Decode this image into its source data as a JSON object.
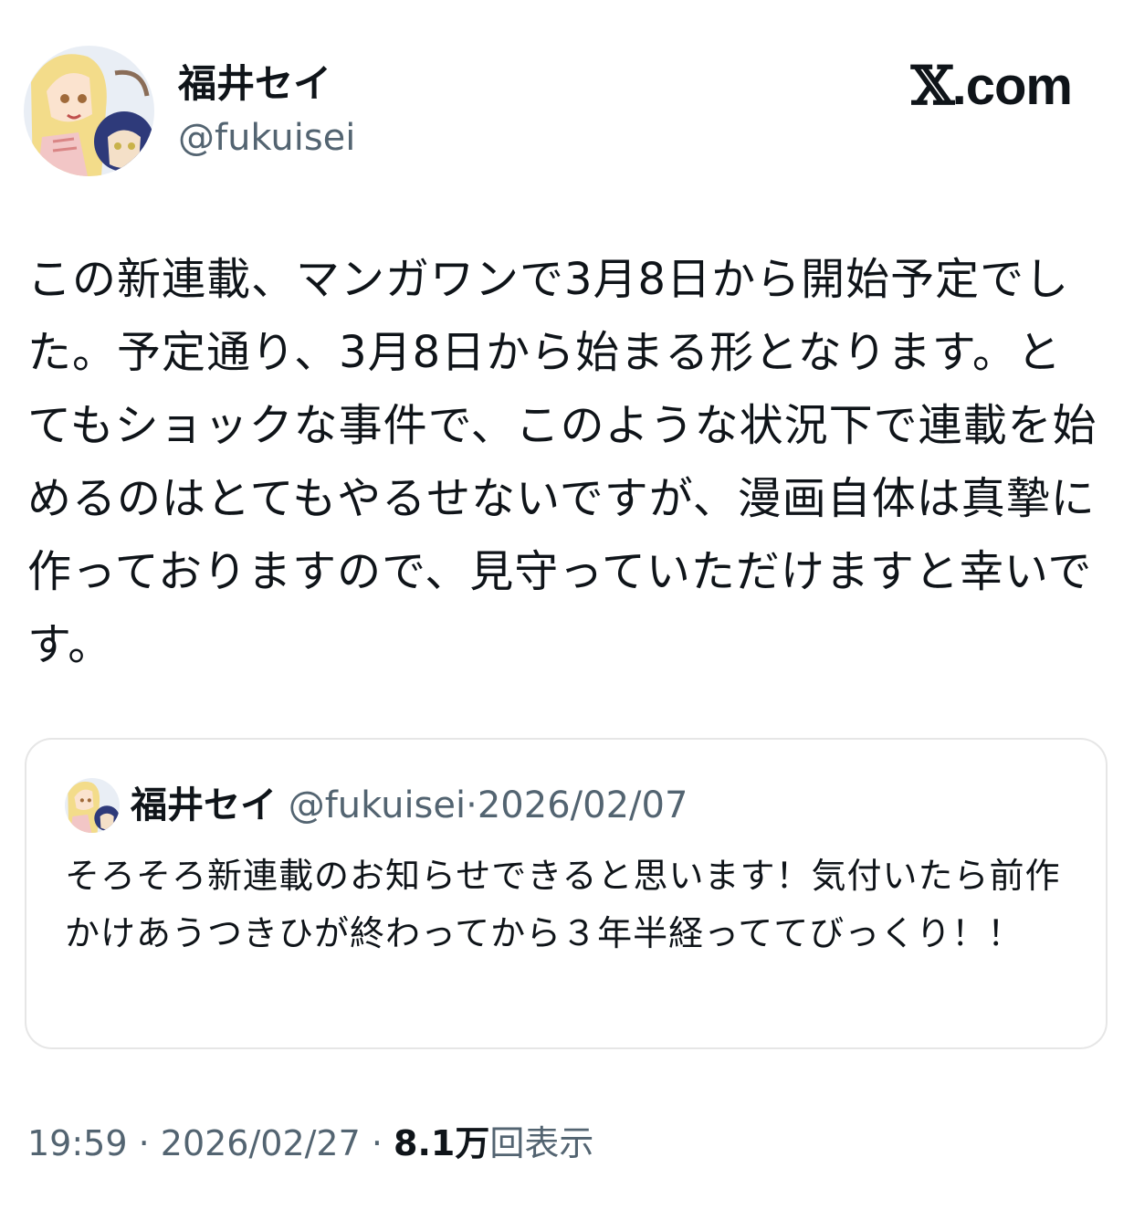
{
  "author": {
    "display_name": "福井セイ",
    "handle": "@fukuisei"
  },
  "brand": {
    "label": ".com",
    "icon": "x-logo-icon"
  },
  "tweet": {
    "text": "この新連載、マンガワンで3月8日から開始予定でした。予定通り、3月8日から始まる形となります。とてもショックな事件で、このような状況下で連載を始めるのはとてもやるせないですが、漫画自体は真摯に作っておりますので、見守っていただけますと幸いです。",
    "time": "19:59",
    "date": "2026/02/27",
    "views_count": "8.1万",
    "views_label": "回表示",
    "separator": " · "
  },
  "quoted_tweet": {
    "display_name": "福井セイ",
    "handle": "@fukuisei",
    "separator": "·",
    "date": "2026/02/07",
    "text": "そろそろ新連載のお知らせできると思います！気付いたら前作かけあうつきひが終わってから３年半経っててびっくり！！"
  },
  "colors": {
    "text_primary": "#0f1419",
    "text_secondary": "#536471",
    "border": "#e6e6e6"
  }
}
